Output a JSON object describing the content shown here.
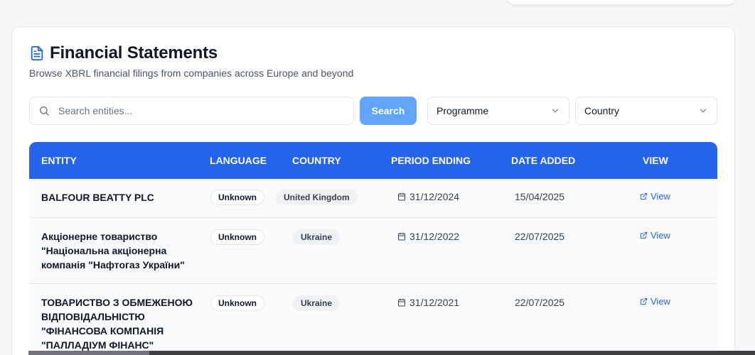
{
  "page": {
    "title": "Financial Statements",
    "subtitle": "Browse XBRL financial filings from companies across Europe and beyond"
  },
  "search": {
    "placeholder": "Search entities...",
    "value": "",
    "button_label": "Search"
  },
  "filters": {
    "programme": "Programme",
    "country": "Country"
  },
  "table": {
    "columns": [
      "ENTITY",
      "LANGUAGE",
      "COUNTRY",
      "PERIOD ENDING",
      "DATE ADDED",
      "VIEW"
    ],
    "rows": [
      {
        "entity": "BALFOUR BEATTY PLC",
        "language": "Unknown",
        "country": "United Kingdom",
        "period_ending": "31/12/2024",
        "date_added": "15/04/2025",
        "view": "View"
      },
      {
        "entity": "Акціонерне товариство \"Національна акціонерна компанія \"Нафтогаз України\"",
        "language": "Unknown",
        "country": "Ukraine",
        "period_ending": "31/12/2022",
        "date_added": "22/07/2025",
        "view": "View"
      },
      {
        "entity": "ТОВАРИСТВО З ОБМЕЖЕНОЮ ВІДПОВІДАЛЬНІСТЮ \"ФІНАНСОВА КОМПАНІЯ \"ПАЛЛАДІУМ ФІНАНС\"",
        "language": "Unknown",
        "country": "Ukraine",
        "period_ending": "31/12/2021",
        "date_added": "22/07/2025",
        "view": "View"
      }
    ]
  },
  "colors": {
    "header_bg": "#2563eb",
    "search_button": "#60a5fa",
    "link": "#2563eb"
  },
  "icons": [
    "document-icon",
    "search-icon",
    "chevron-down-icon",
    "calendar-icon",
    "external-link-icon"
  ]
}
